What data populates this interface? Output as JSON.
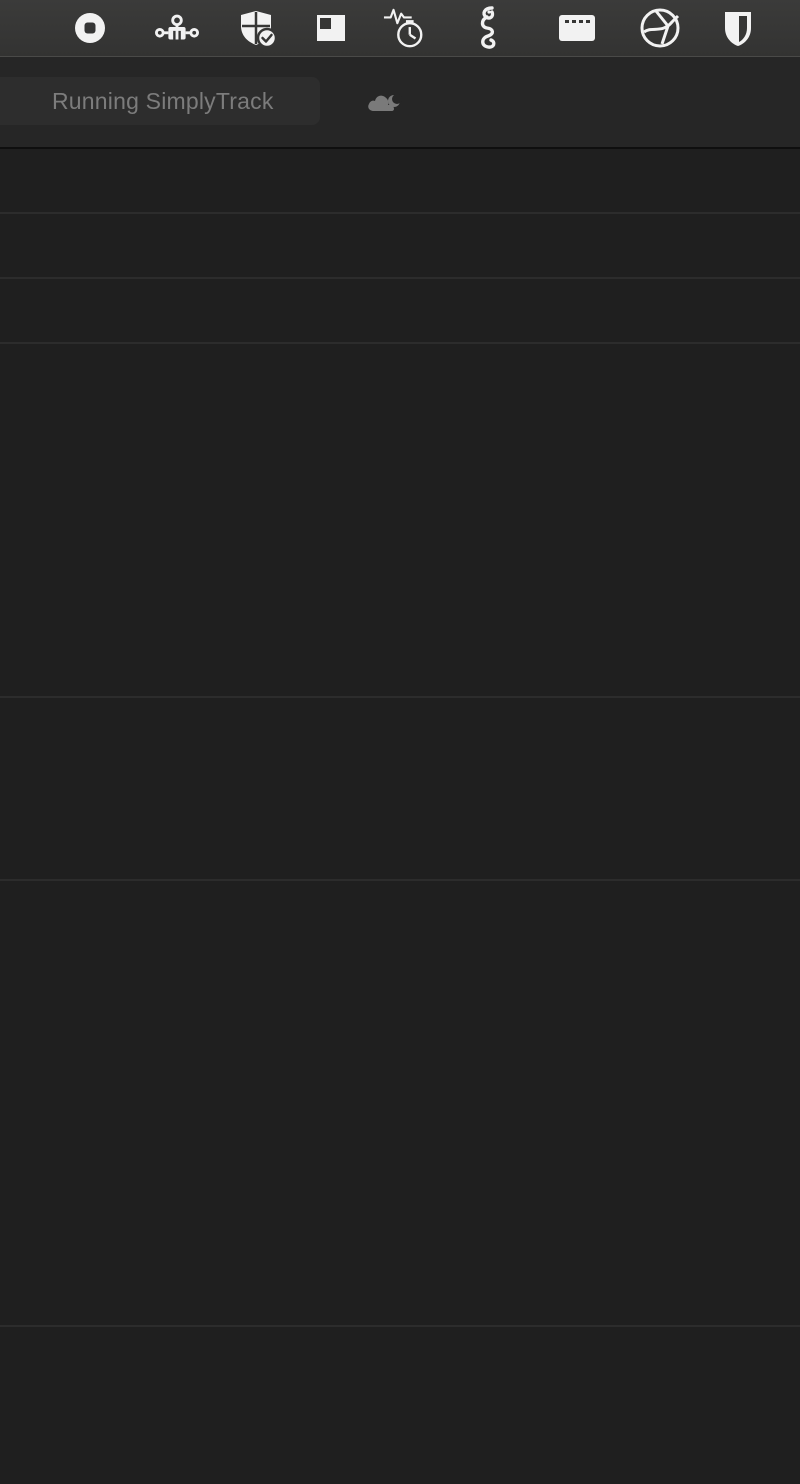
{
  "menubar": {
    "icons": [
      "stop-circle-icon",
      "network-nodes-icon",
      "shield-check-icon",
      "window-layout-icon",
      "activity-timer-icon",
      "seahorse-icon",
      "keyboard-icon",
      "globe-icon",
      "shield-half-icon"
    ]
  },
  "toolbar": {
    "status_text": "Running SimplyTrack",
    "cloud_icon": "cloud-moon-icon"
  },
  "colors": {
    "background": "#1f1f1f",
    "menubar": "#383837",
    "toolbar": "#262626",
    "status_text": "#7c7c7c",
    "icon": "#f2f2f2",
    "divider": "#2c2c2c"
  }
}
